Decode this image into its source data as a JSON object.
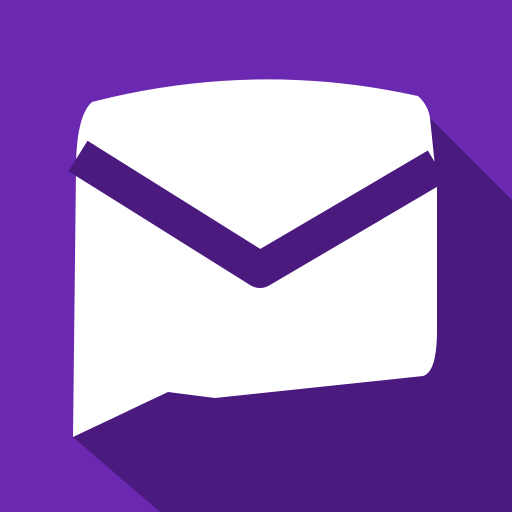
{
  "icon": {
    "name": "mail-chat-bubble-icon",
    "colors": {
      "background": "#6B28B0",
      "long_shadow": "#4A1A7F",
      "bubble": "#FFFFFF",
      "envelope_fold": "#4A1A7F"
    }
  }
}
